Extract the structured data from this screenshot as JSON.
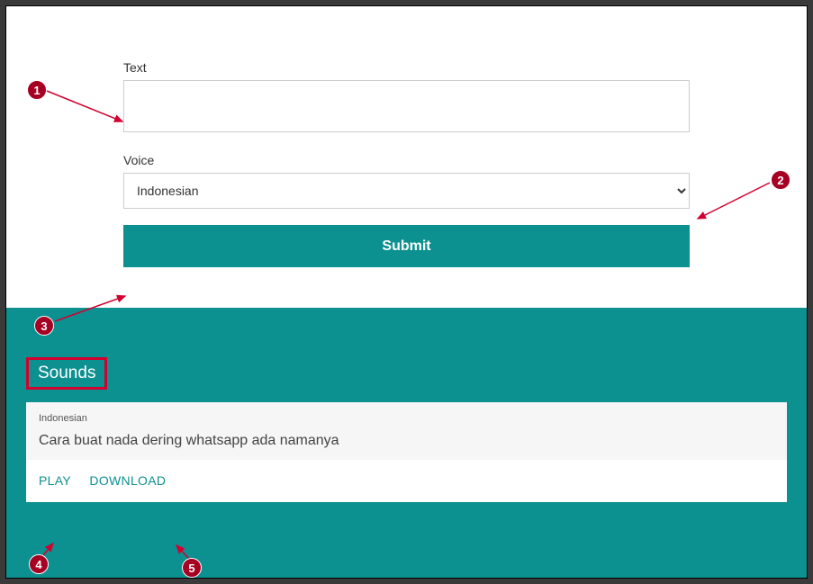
{
  "form": {
    "text_label": "Text",
    "text_value": "",
    "voice_label": "Voice",
    "voice_selected": "Indonesian",
    "submit_label": "Submit"
  },
  "sounds": {
    "title": "Sounds",
    "items": [
      {
        "language": "Indonesian",
        "text": "Cara buat nada dering whatsapp ada namanya",
        "play_label": "PLAY",
        "download_label": "DOWNLOAD"
      }
    ]
  },
  "annotations": {
    "b1": "1",
    "b2": "2",
    "b3": "3",
    "b4": "4",
    "b5": "5"
  }
}
